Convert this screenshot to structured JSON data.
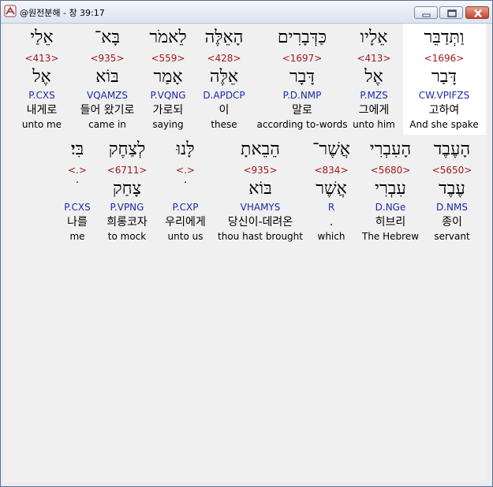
{
  "window": {
    "title": "@원전분해 - 창 39:17"
  },
  "colors": {
    "strong": "#a0191e",
    "morph": "#1c2aa7",
    "text": "#000000",
    "selected_background": "#ffffff"
  },
  "rows": [
    {
      "words": [
        {
          "hebrew": "וַתְּדַבֵּר",
          "strong": "<1696>",
          "lemma": "דָּבַר",
          "morph": "CW.VPIFZS",
          "korean": "고하여",
          "english": "And she spake",
          "selected": true
        },
        {
          "hebrew": "אֵלָיו",
          "strong": "<413>",
          "lemma": "אֶל",
          "morph": "P.MZS",
          "korean": "그에게",
          "english": "unto him"
        },
        {
          "hebrew": "כַּדְּבָרִים",
          "strong": "<1697>",
          "lemma": "דָּבָר",
          "morph": "P.D.NMP",
          "korean": "말로",
          "english": "according to-words"
        },
        {
          "hebrew": "הָאֵלֶּה",
          "strong": "<428>",
          "lemma": "אֵלֶּה",
          "morph": "D.APDCP",
          "korean": "이",
          "english": "these"
        },
        {
          "hebrew": "לֵאמֹר",
          "strong": "<559>",
          "lemma": "אָמַר",
          "morph": "P.VQNG",
          "korean": "가로되",
          "english": "saying"
        },
        {
          "hebrew": "בָּא־",
          "strong": "<935>",
          "lemma": "בּוֹא",
          "morph": "VQAMZS",
          "korean": "들어 왔기로",
          "english": "came in"
        },
        {
          "hebrew": "אֵלַי",
          "strong": "<413>",
          "lemma": "אֶל",
          "morph": "P.CXS",
          "korean": "내게로",
          "english": "unto me"
        }
      ]
    },
    {
      "words": [
        {
          "hebrew": "הָעֶבֶד",
          "strong": "<5650>",
          "lemma": "עֶבֶד",
          "morph": "D.NMS",
          "korean": "종이",
          "english": "servant"
        },
        {
          "hebrew": "הָעִבְרִי",
          "strong": "<5680>",
          "lemma": "עִבְרִי",
          "morph": "D.NGe",
          "korean": "히브리",
          "english": "The Hebrew"
        },
        {
          "hebrew": "אֲשֶׁר־",
          "strong": "<834>",
          "lemma": "אֲשֶׁר",
          "morph": "R",
          "korean": ".",
          "english": "which"
        },
        {
          "hebrew": "הֵבֵאתָ",
          "strong": "<935>",
          "lemma": "בּוֹא",
          "morph": "VHAMYS",
          "korean": "당신이-데려온",
          "english": "thou hast brought"
        },
        {
          "hebrew": "לָּנוּ",
          "strong": "<.>",
          "lemma": "ׁ",
          "morph": "P.CXP",
          "korean": "우리에게",
          "english": "unto us"
        },
        {
          "hebrew": "לְצַחֶק",
          "strong": "<6711>",
          "lemma": "צָחַק",
          "morph": "P.VPNG",
          "korean": "희롱코자",
          "english": "to mock"
        },
        {
          "hebrew": "בִּי׃",
          "strong": "<.>",
          "lemma": "ׁ",
          "morph": "P.CXS",
          "korean": "나를",
          "english": "me"
        }
      ]
    }
  ]
}
